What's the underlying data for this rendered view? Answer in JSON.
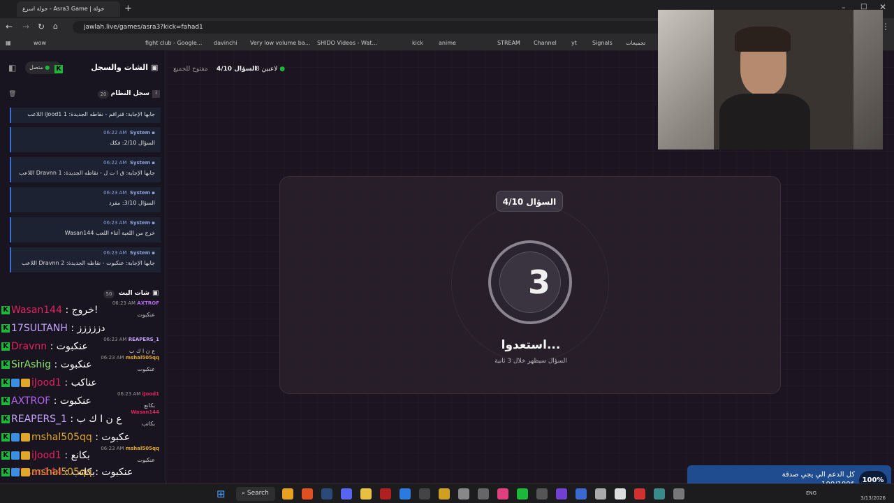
{
  "browser": {
    "tab_title": "جولة اسرع - Asra3 Game | جولة",
    "url": "jawlah.live/games/asra3?kick=fahad1",
    "bookmarks": [
      "wow",
      "fight club - Google...",
      "davinchi",
      "Very low volume ba...",
      "SHIDO Videos - Wat...",
      "kick",
      "anime",
      "STREAM",
      "Channel",
      "yt",
      "Signals",
      "تجميعات"
    ]
  },
  "sidebar": {
    "title": "الشات والسجل",
    "status": "متصل",
    "system_log": {
      "title": "سجل النظام",
      "count": "20",
      "messages": [
        {
          "sender": "",
          "time": "",
          "text": "اللاعب iJood1 جابها الإجابة: قنراقم - نقاطه الجديدة: 1"
        },
        {
          "sender": "System",
          "time": "06:22 AM",
          "text": "السؤال 2/10: فكك"
        },
        {
          "sender": "System",
          "time": "06:22 AM",
          "text": "اللاعب Dravnn جابها الإجابة: ق ا ت ل - نقاطه الجديدة: 1"
        },
        {
          "sender": "System",
          "time": "06:23 AM",
          "text": "السؤال 3/10: مفرد"
        },
        {
          "sender": "System",
          "time": "06:23 AM",
          "text": "Wasan144 خرج من اللعبة أثناء اللعب"
        },
        {
          "sender": "System",
          "time": "06:23 AM",
          "text": "اللاعب Dravnn جابها الإجابة: عنكبوت - نقاطه الجديدة: 2"
        }
      ]
    },
    "live_chat": {
      "title": "شات البث",
      "count": "50"
    },
    "chat_lines": [
      {
        "user": "Wasan144",
        "color": "#e0245e",
        "msg": "خروج!",
        "meta_user": "AXTROF",
        "meta_color": "#b565f0",
        "time": "06:23 AM",
        "under": "عنكبوت",
        "crown": false
      },
      {
        "user": "17SULTANH",
        "color": "#c7a6ff",
        "msg": "دززززز",
        "meta_user": "",
        "meta_color": "",
        "time": "",
        "under": "",
        "crown": false
      },
      {
        "user": "Dravnn",
        "color": "#e0245e",
        "msg": "عنكبوت",
        "meta_user": "REAPERS_1",
        "meta_color": "#c7a6ff",
        "time": "06:23 AM",
        "under": "ع ن ا ك ب",
        "crown": false
      },
      {
        "user": "SirAshig",
        "color": "#8de36f",
        "msg": "عنكبوت",
        "meta_user": "mshal505qq",
        "meta_color": "#e0a82a",
        "time": "06:23 AM",
        "under": "عنكبوت",
        "crown": false
      },
      {
        "user": "iJood1",
        "color": "#e0245e",
        "msg": "عناكب",
        "meta_user": "",
        "meta_color": "",
        "time": "",
        "under": "",
        "crown": true
      },
      {
        "user": "AXTROF",
        "color": "#b565f0",
        "msg": "عنكبوت",
        "meta_user": "iJood1",
        "meta_color": "#e0245e",
        "time": "06:23 AM",
        "under": "بكانع",
        "crown": false
      },
      {
        "user": "REAPERS_1",
        "color": "#c7a6ff",
        "msg": "ع ن ا ك ب",
        "meta_user": "Wasan144",
        "meta_color": "#e0245e",
        "time": "",
        "under": "بكاتب",
        "crown": false
      },
      {
        "user": "mshal505qq",
        "color": "#e0a82a",
        "msg": "عكبوت",
        "meta_user": "",
        "meta_color": "",
        "time": "",
        "under": "",
        "crown": true
      },
      {
        "user": "iJood1",
        "color": "#e0245e",
        "msg": "بكانع",
        "meta_user": "mshal505qq",
        "meta_color": "#e0a82a",
        "time": "06:23 AM",
        "under": "عنكبوت",
        "crown": true
      },
      {
        "user": "Wasan144",
        "color": "#e0245e",
        "msg": "بكاتب",
        "meta_user": "",
        "meta_color": "",
        "time": "",
        "under": "",
        "crown": false
      },
      {
        "user": "mshal505qq",
        "color": "#e0a82a",
        "msg": "عنكبوت",
        "meta_user": "",
        "meta_color": "",
        "time": "",
        "under": "",
        "crown": true
      }
    ]
  },
  "game_header": {
    "players": "8 لاعبين",
    "question": "السؤال 4/10",
    "mode": "مفتوح للجميع"
  },
  "game": {
    "question_badge": "السؤال 4/10",
    "countdown": "3",
    "ready_text": "استعدوا...",
    "subtitle": "السؤال سيظهر خلال 3 ثانية"
  },
  "taskbar": {
    "search_label": "Search",
    "lang": "ENG",
    "date": "3/13/2026"
  },
  "donation": {
    "title": "كل الدعم الي يجي صدقة",
    "amount": "100/100$",
    "percent": "100%"
  },
  "colors": {
    "kick_green": "#1bb83a",
    "system_blue": "#3a6fd8",
    "donation_blue": "#1f4b8f"
  }
}
